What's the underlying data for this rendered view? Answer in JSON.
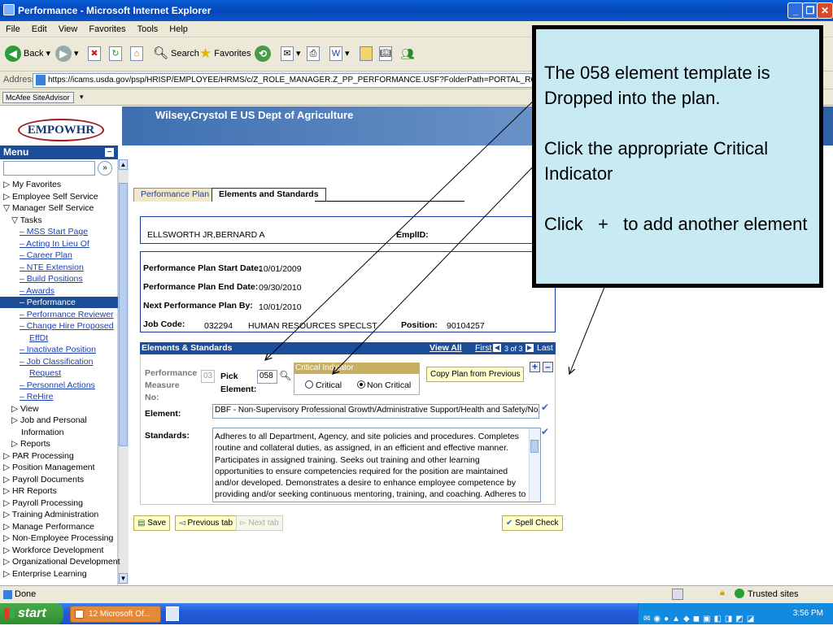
{
  "window": {
    "title": "Performance - Microsoft Internet Explorer"
  },
  "menubar": [
    "File",
    "Edit",
    "View",
    "Favorites",
    "Tools",
    "Help"
  ],
  "toolbar": {
    "back": "Back",
    "search": "Search",
    "favorites": "Favorites"
  },
  "address": {
    "label": "Address",
    "url": "https://icams.usda.gov/psp/HRISP/EMPLOYEE/HRMS/c/Z_ROLE_MANAGER.Z_PP_PERFORMANCE.USF?FolderPath=PORTAL_ROOT_OBJECT.CO_MANAGER"
  },
  "mcafee": {
    "label": "McAfee SiteAdvisor"
  },
  "banner": {
    "user": "Wilsey,Crystol E  US Dept of Agriculture",
    "logo": "EMPOWHR"
  },
  "sidebar": {
    "title": "Menu",
    "items": [
      {
        "label": "▷ My Favorites",
        "type": "plain"
      },
      {
        "label": "▷ Employee Self Service",
        "type": "plain"
      },
      {
        "label": "▽ Manager Self Service",
        "type": "plain"
      },
      {
        "label": "▽ Tasks",
        "type": "plain"
      },
      {
        "label": "– MSS Start Page",
        "type": "link"
      },
      {
        "label": "– Acting In Lieu Of",
        "type": "link"
      },
      {
        "label": "– Career Plan",
        "type": "link"
      },
      {
        "label": "– NTE Extension",
        "type": "link"
      },
      {
        "label": "– Build Positions",
        "type": "link"
      },
      {
        "label": "– Awards",
        "type": "link"
      },
      {
        "label": "– Performance",
        "type": "sel"
      },
      {
        "label": "– Performance Reviewer",
        "type": "link"
      },
      {
        "label": "– Change Hire Proposed",
        "type": "link"
      },
      {
        "label": "EffDt",
        "type": "link"
      },
      {
        "label": "– Inactivate Position",
        "type": "link"
      },
      {
        "label": "– Job Classification",
        "type": "link"
      },
      {
        "label": "Request",
        "type": "link"
      },
      {
        "label": "– Personnel Actions",
        "type": "link"
      },
      {
        "label": "– ReHire",
        "type": "link"
      },
      {
        "label": "▷ View",
        "type": "plain"
      },
      {
        "label": "▷ Job and Personal",
        "type": "plain"
      },
      {
        "label": "Information",
        "type": "plain"
      },
      {
        "label": "▷ Reports",
        "type": "plain"
      },
      {
        "label": "▷ PAR Processing",
        "type": "plain"
      },
      {
        "label": "▷ Position Management",
        "type": "plain"
      },
      {
        "label": "▷ Payroll Documents",
        "type": "plain"
      },
      {
        "label": "▷ HR Reports",
        "type": "plain"
      },
      {
        "label": "▷ Payroll Processing",
        "type": "plain"
      },
      {
        "label": "▷ Training Administration",
        "type": "plain"
      },
      {
        "label": "▷ Manage Performance",
        "type": "plain"
      },
      {
        "label": "▷ Non-Employee Processing",
        "type": "plain"
      },
      {
        "label": "▷ Workforce Development",
        "type": "plain"
      },
      {
        "label": "▷ Organizational Development",
        "type": "plain"
      },
      {
        "label": "▷ Enterprise Learning",
        "type": "plain"
      }
    ]
  },
  "tabs": {
    "plan": "Performance Plan",
    "elements": "Elements and Standards"
  },
  "employee": {
    "name": "ELLSWORTH JR,BERNARD A",
    "emplid_label": "EmplID:"
  },
  "plan": {
    "start_label": "Performance Plan Start Date:",
    "start": "10/01/2009",
    "end_label": "Performance Plan End Date:",
    "end": "09/30/2010",
    "next_label": "Next Performance Plan By:",
    "next": "10/01/2010",
    "job_label": "Job Code:",
    "job": "032294",
    "job_title": "HUMAN RESOURCES SPECLST",
    "position_label": "Position:",
    "position": "90104257"
  },
  "elements": {
    "header": "Elements & Standards",
    "view_all": "View All",
    "first": "First",
    "page": "3 of 3",
    "last": "Last",
    "measure_label": "Performance Measure No:",
    "measure_val": "03",
    "pick_label": "Pick Element:",
    "pick_val": "058",
    "ci_title": "Critical Indicator",
    "critical": "Critical",
    "non_critical": "Non Critical",
    "copy_btn": "Copy Plan from Previous Y",
    "element_label": "Element:",
    "element_val": "DBF - Non-Supervisory Professional Growth/Administrative Support/Health and Safety/Non-Critical",
    "standards_label": "Standards:",
    "standards_val": "Adheres to all Department, Agency, and site policies and procedures.  Completes routine and collateral duties, as assigned, in an efficient and effective manner.  Participates in assigned training.  Seeks out training and other learning opportunities to ensure competencies required for the position are maintained and/or developed.  Demonstrates a desire to enhance employee competence by providing and/or seeking continuous mentoring, training, and coaching.  Adheres to health and safety standards."
  },
  "buttons": {
    "save": "Save",
    "prev": "Previous tab",
    "next": "Next tab",
    "spell": "Spell Check"
  },
  "callout": {
    "line1": "The 058 element template is Dropped into the plan.",
    "line2": "Click the appropriate Critical Indicator",
    "line3": "Click   +   to add another element"
  },
  "status": {
    "left": "Done",
    "zone": "Trusted sites"
  },
  "taskbar": {
    "start": "start",
    "task": "12 Microsoft Of...",
    "time": "3:56 PM"
  }
}
